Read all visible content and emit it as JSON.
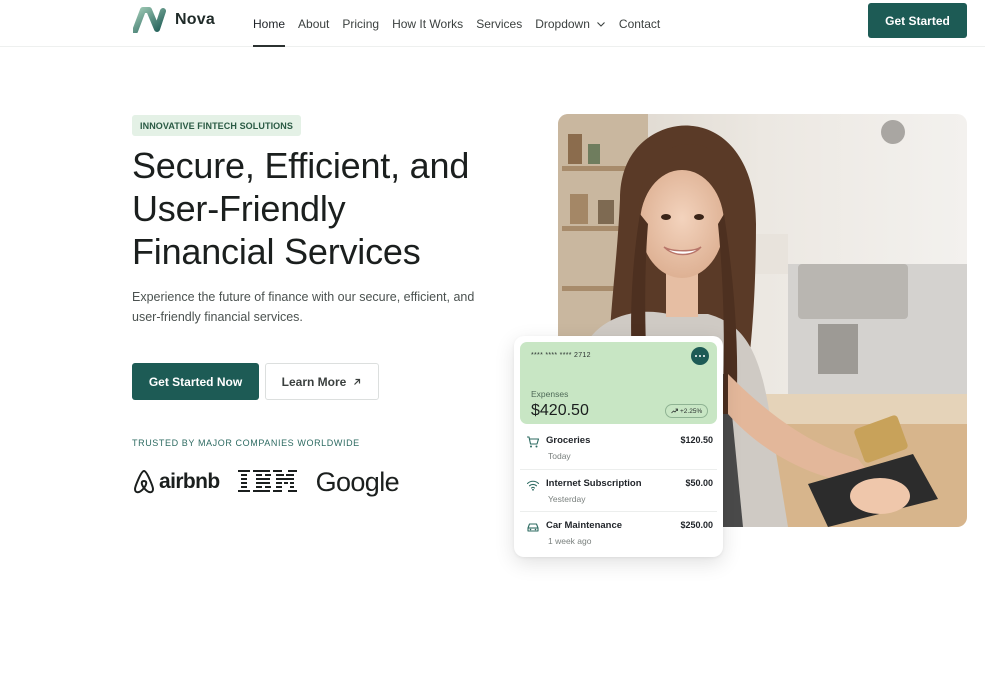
{
  "nav": {
    "brand": "Nova",
    "items": [
      "Home",
      "About",
      "Pricing",
      "How It Works",
      "Services",
      "Dropdown",
      "Contact"
    ],
    "active": "Home",
    "cta": "Get Started"
  },
  "hero": {
    "badge": "INNOVATIVE FINTECH SOLUTIONS",
    "headline_lines": [
      "Secure, Efficient, and",
      "User-Friendly",
      "Financial Services"
    ],
    "subtext": "Experience the future of finance with our secure, efficient, and user-friendly financial services.",
    "primary_button": "Get Started Now",
    "secondary_button": "Learn More",
    "trusted_label": "TRUSTED BY MAJOR COMPANIES WORLDWIDE",
    "partner_logos": [
      "airbnb",
      "IBM",
      "Google"
    ]
  },
  "card": {
    "card_number": "**** **** **** 2712",
    "expenses_label": "Expenses",
    "expenses_amount": "$420.50",
    "trend": "+2.25%",
    "transactions": [
      {
        "icon": "cart-icon",
        "name": "Groceries",
        "time": "Today",
        "amount": "$120.50"
      },
      {
        "icon": "wifi-icon",
        "name": "Internet Subscription",
        "time": "Yesterday",
        "amount": "$50.00"
      },
      {
        "icon": "car-icon",
        "name": "Car Maintenance",
        "time": "1 week ago",
        "amount": "$250.00"
      }
    ]
  },
  "colors": {
    "primary": "#1d5b55",
    "badge_bg": "#e4f1e6",
    "card_accent": "#c8e6c4"
  }
}
